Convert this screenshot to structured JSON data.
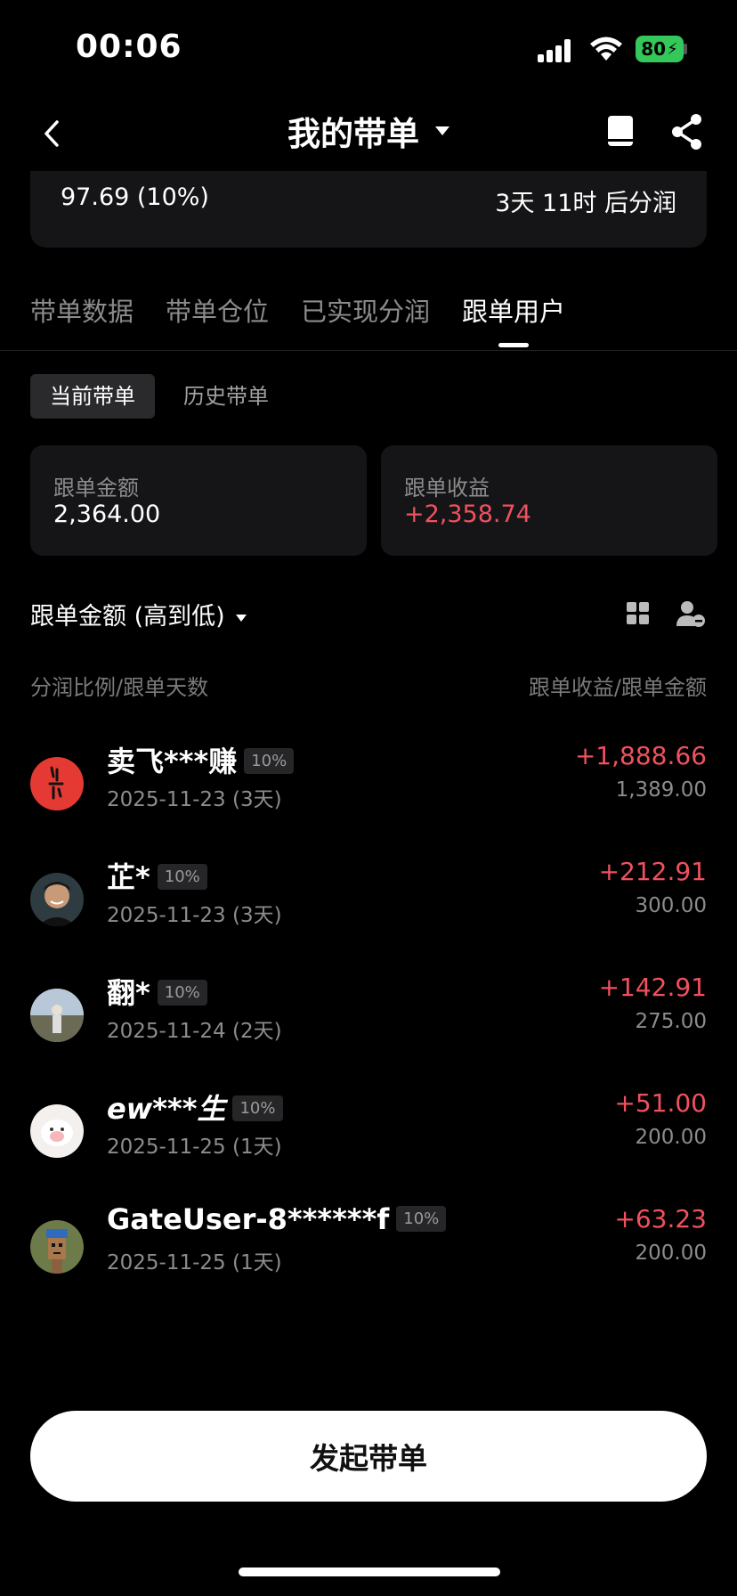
{
  "status": {
    "time": "00:06",
    "battery": "80"
  },
  "header": {
    "title": "我的带单"
  },
  "summary": {
    "left_value": "97.69 (10%)",
    "right_value": "3天 11时 后分润"
  },
  "tabs": [
    {
      "label": "带单数据"
    },
    {
      "label": "带单仓位"
    },
    {
      "label": "已实现分润"
    },
    {
      "label": "跟单用户"
    }
  ],
  "subtabs": [
    {
      "label": "当前带单"
    },
    {
      "label": "历史带单"
    }
  ],
  "stats": {
    "amount_label": "跟单金额",
    "amount_value": "2,364.00",
    "profit_label": "跟单收益",
    "profit_value": "+2,358.74"
  },
  "sort": {
    "label": "跟单金额 (高到低)"
  },
  "columns": {
    "left": "分润比例/跟单天数",
    "right": "跟单收益/跟单金额"
  },
  "followers": [
    {
      "name": "卖飞***赚",
      "ratio": "10%",
      "date": "2025-11-23 (3天)",
      "profit": "+1,888.66",
      "amount": "1,389.00"
    },
    {
      "name": "芷*",
      "ratio": "10%",
      "date": "2025-11-23 (3天)",
      "profit": "+212.91",
      "amount": "300.00"
    },
    {
      "name": "翻*",
      "ratio": "10%",
      "date": "2025-11-24 (2天)",
      "profit": "+142.91",
      "amount": "275.00"
    },
    {
      "name": "ew***生",
      "ratio": "10%",
      "date": "2025-11-25 (1天)",
      "profit": "+51.00",
      "amount": "200.00"
    },
    {
      "name": "GateUser-8******f",
      "ratio": "10%",
      "date": "2025-11-25 (1天)",
      "profit": "+63.23",
      "amount": "200.00"
    }
  ],
  "cta": {
    "label": "发起带单"
  },
  "colors": {
    "positive": "#f0515e",
    "background": "#000000",
    "card": "#151517"
  }
}
